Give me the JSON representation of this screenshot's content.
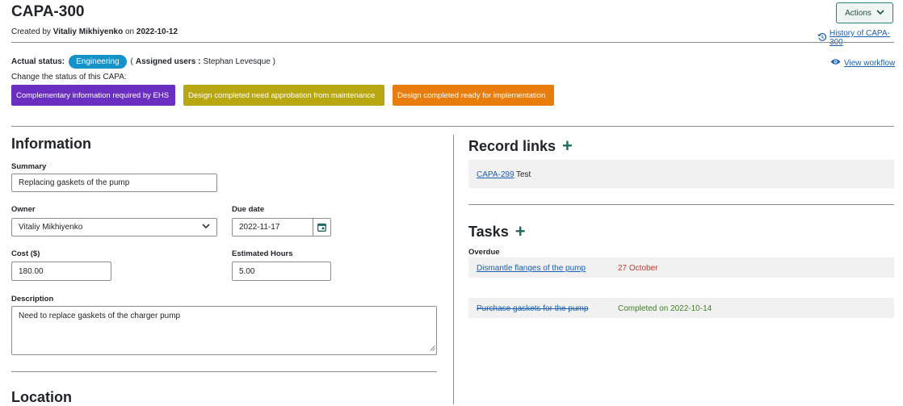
{
  "header": {
    "title": "CAPA-300",
    "created_prefix": "Created by",
    "created_by": "Vitaliy Mikhiyenko",
    "created_on_word": "on",
    "created_date": "2022-10-12",
    "actions_label": "Actions",
    "history_label": "History of CAPA-300"
  },
  "status": {
    "actual_label": "Actual status:",
    "current": "Engineering",
    "assigned_open": "(",
    "assigned_label": "Assigned users :",
    "assigned_users": "Stephan Levesque )",
    "change_label": "Change the status of this CAPA:",
    "view_workflow": "View workflow",
    "buttons": [
      {
        "label": "Complementary information required by EHS",
        "color": "#6a2fc0"
      },
      {
        "label": "Design completed need approbation from maintenance",
        "color": "#b8a711"
      },
      {
        "label": "Design completed ready for implementation",
        "color": "#e87d0d"
      }
    ]
  },
  "information": {
    "heading": "Information",
    "summary_label": "Summary",
    "summary_value": "Replacing gaskets of the pump",
    "owner_label": "Owner",
    "owner_value": "Vitaliy Mikhiyenko",
    "due_label": "Due date",
    "due_value": "2022-11-17",
    "cost_label": "Cost ($)",
    "cost_value": "180.00",
    "hours_label": "Estimated Hours",
    "hours_value": "5.00",
    "description_label": "Description",
    "description_value": "Need to replace gaskets of the charger pump",
    "location_heading": "Location"
  },
  "record_links": {
    "heading": "Record links",
    "items": [
      {
        "id": "CAPA-299",
        "text": "Test"
      }
    ]
  },
  "tasks": {
    "heading": "Tasks",
    "overdue_label": "Overdue",
    "items": [
      {
        "name": "Dismantle flanges of the pump",
        "status": "27 October",
        "status_color": "#c0392b"
      },
      {
        "name": "Purchase gaskets for the pump",
        "status": "Completed on 2022-10-14",
        "status_color": "#3f7d2a"
      }
    ]
  }
}
